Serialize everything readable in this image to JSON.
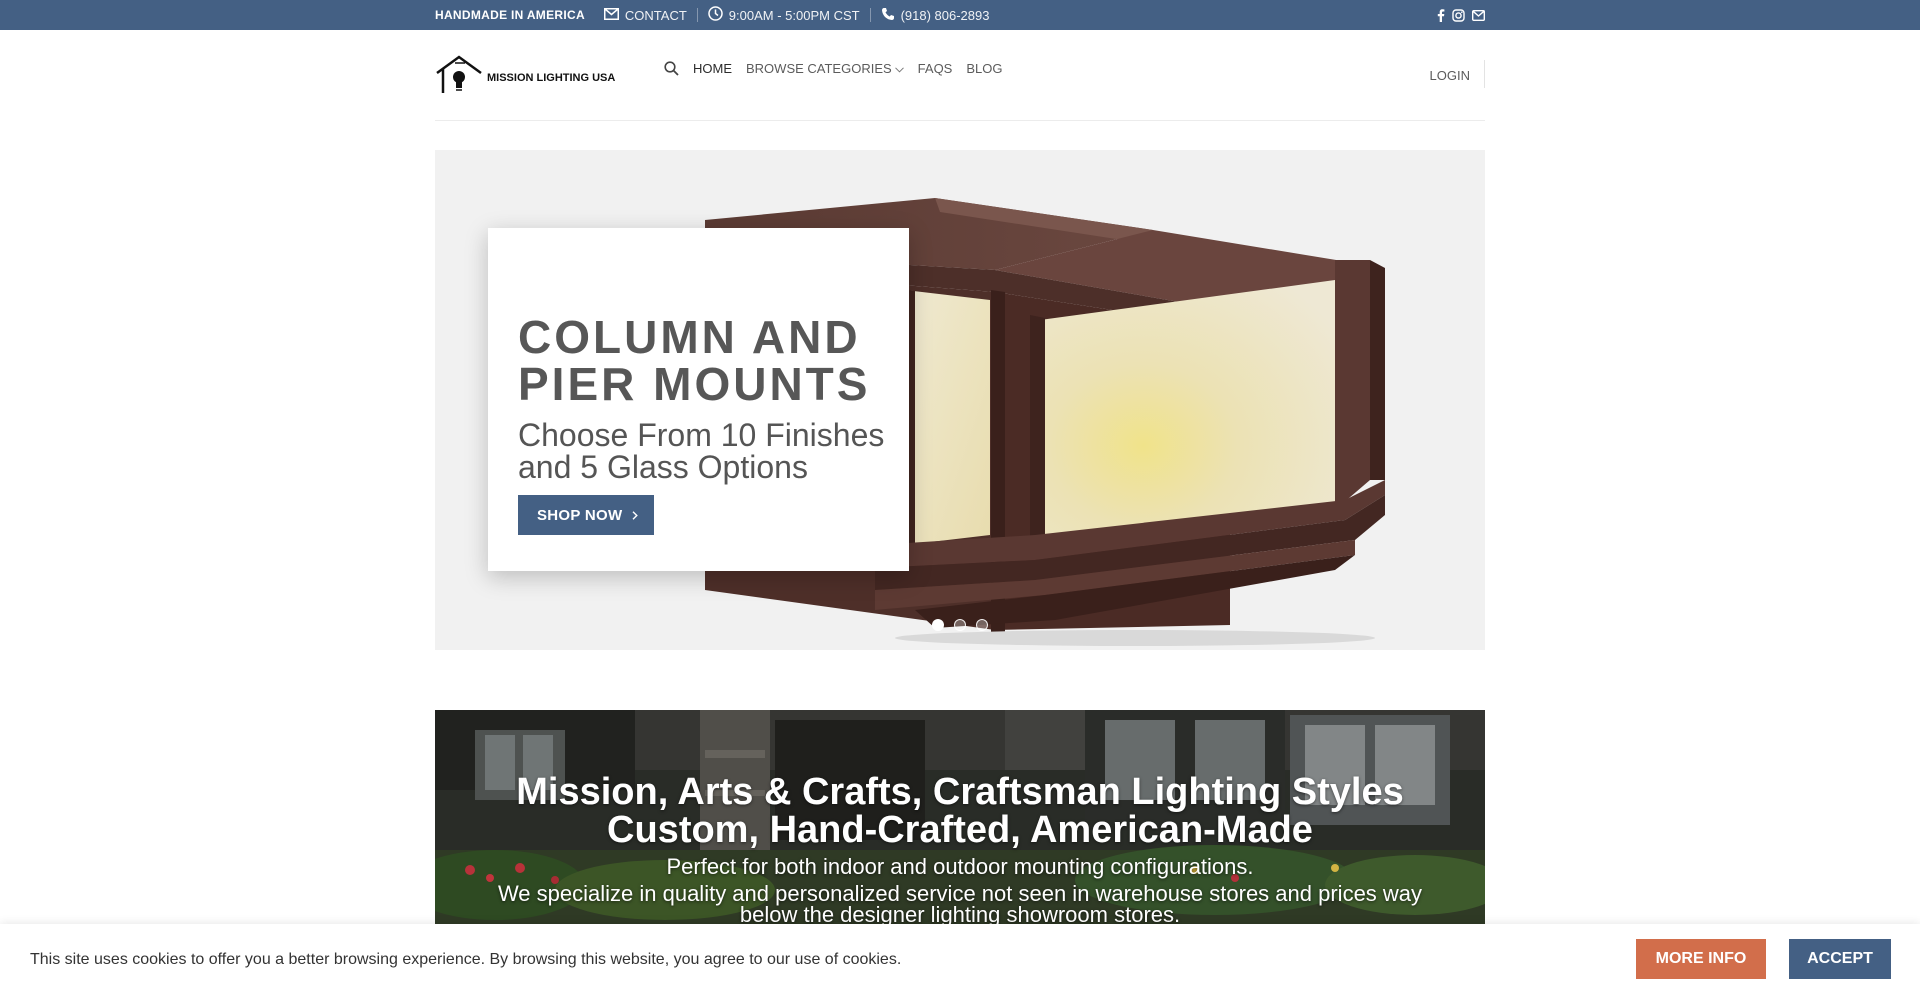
{
  "colors": {
    "primary": "#446084",
    "secondary": "#d26e4b",
    "topbar": "#446084"
  },
  "topbar": {
    "tagline": "HANDMADE IN AMERICA",
    "contact_label": "CONTACT",
    "contact_icon": "envelope-icon",
    "hours": "9:00AM - 5:00PM CST",
    "hours_icon": "clock-icon",
    "phone": "(918) 806-2893",
    "phone_icon": "phone-icon",
    "social_icons": [
      "facebook-icon",
      "instagram-icon",
      "email-icon"
    ]
  },
  "header": {
    "logo_text": "MISSION LIGHTING USA",
    "search_icon": "search-icon",
    "nav": [
      {
        "label": "HOME"
      },
      {
        "label": "BROWSE CATEGORIES"
      },
      {
        "label": "FAQS"
      },
      {
        "label": "BLOG"
      }
    ],
    "login_label": "LOGIN"
  },
  "hero": {
    "title": "COLUMN AND PIER MOUNTS",
    "subtitle": "Choose From 10 Finishes and 5 Glass Options",
    "button_label": "SHOP NOW",
    "slide_count": 3,
    "active_slide": 1
  },
  "banner": {
    "heading_1": "Mission, Arts & Crafts, Craftsman Lighting Styles",
    "heading_2": "Custom, Hand-Crafted, American-Made",
    "text_1": "Perfect for both indoor and outdoor mounting configurations.",
    "text_2": "We specialize in quality and personalized service not seen in warehouse stores and prices way below the designer lighting showroom stores."
  },
  "cookie": {
    "text": "This site uses cookies to offer you a better browsing experience. By browsing this website, you agree to our use of cookies.",
    "more_info_label": "MORE INFO",
    "accept_label": "ACCEPT"
  }
}
